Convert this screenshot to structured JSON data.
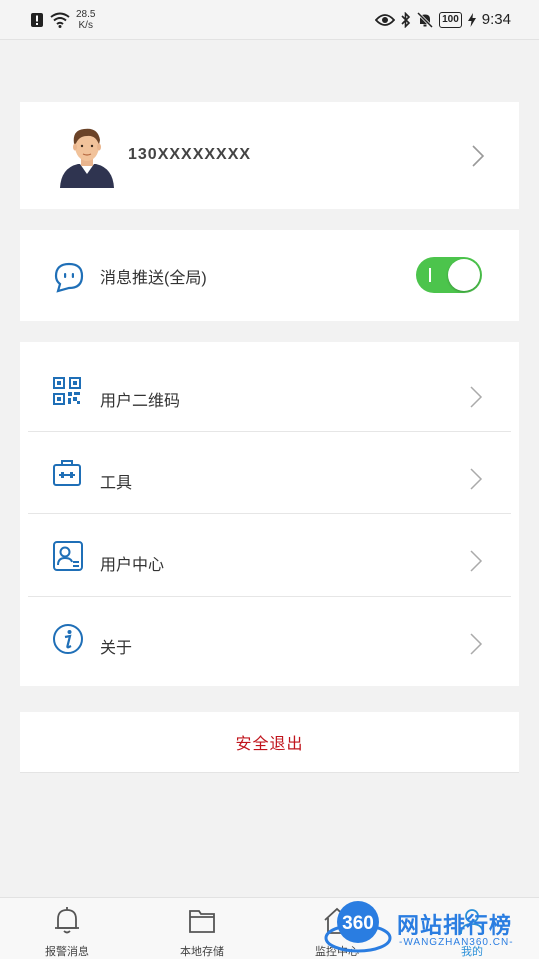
{
  "status_bar": {
    "speed_value": "28.5",
    "speed_unit": "K/s",
    "battery": "100",
    "time": "9:34"
  },
  "profile": {
    "phone": "130XXXXXXXX"
  },
  "push": {
    "label": "消息推送(全局)",
    "enabled": true,
    "toggle_color": "#4cc44c"
  },
  "menu": {
    "items": [
      {
        "label": "用户二维码",
        "icon": "qr-code-icon"
      },
      {
        "label": "工具",
        "icon": "toolbox-icon"
      },
      {
        "label": "用户中心",
        "icon": "user-card-icon"
      },
      {
        "label": "关于",
        "icon": "info-icon"
      }
    ]
  },
  "logout": {
    "label": "安全退出",
    "color": "#c0141c"
  },
  "tabbar": {
    "tabs": [
      {
        "label": "报警消息",
        "icon": "bell-icon"
      },
      {
        "label": "本地存储",
        "icon": "folder-icon"
      },
      {
        "label": "监控中心",
        "icon": "home-icon"
      },
      {
        "label": "我的",
        "icon": "user-icon"
      }
    ]
  },
  "watermark": {
    "logo": "360",
    "title": "网站排行榜",
    "subtitle": "-WANGZHAN360.CN-"
  },
  "accent_color": "#1f6fb7"
}
